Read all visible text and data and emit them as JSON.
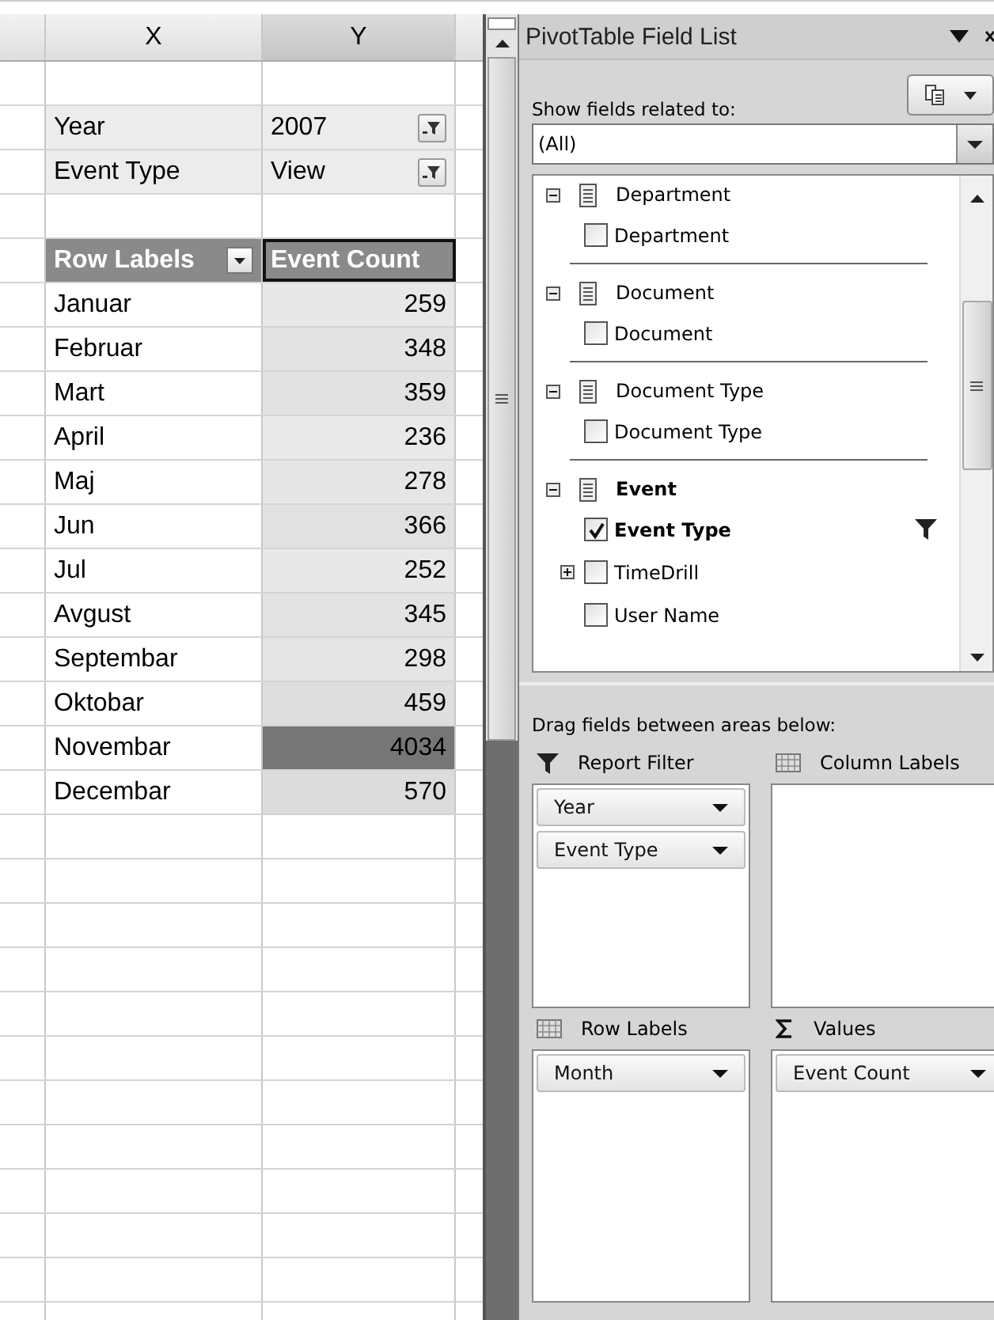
{
  "sheet": {
    "columns": [
      "X",
      "Y"
    ],
    "filters": [
      {
        "label": "Year",
        "value": "2007"
      },
      {
        "label": "Event Type",
        "value": "View"
      }
    ],
    "header": {
      "row_label": "Row Labels",
      "value_label": "Event Count"
    },
    "rows": [
      {
        "label": "Januar",
        "value": "259",
        "color": "#e8e8e8"
      },
      {
        "label": "Februar",
        "value": "348",
        "color": "#e3e3e3"
      },
      {
        "label": "Mart",
        "value": "359",
        "color": "#e2e2e2"
      },
      {
        "label": "April",
        "value": "236",
        "color": "#e9e9e9"
      },
      {
        "label": "Maj",
        "value": "278",
        "color": "#e6e6e6"
      },
      {
        "label": "Jun",
        "value": "366",
        "color": "#e1e1e1"
      },
      {
        "label": "Jul",
        "value": "252",
        "color": "#e8e8e8"
      },
      {
        "label": "Avgust",
        "value": "345",
        "color": "#e3e3e3"
      },
      {
        "label": "Septembar",
        "value": "298",
        "color": "#e5e5e5"
      },
      {
        "label": "Oktobar",
        "value": "459",
        "color": "#dedede"
      },
      {
        "label": "Novembar",
        "value": "4034",
        "color": "#767676"
      },
      {
        "label": "Decembar",
        "value": "570",
        "color": "#dcdcdc"
      }
    ]
  },
  "panel": {
    "title": "PivotTable Field List",
    "related_label": "Show fields related to:",
    "related_value": "(All)",
    "groups": [
      {
        "name": "Department",
        "children": [
          {
            "name": "Department",
            "checked": false
          }
        ]
      },
      {
        "name": "Document",
        "children": [
          {
            "name": "Document",
            "checked": false
          }
        ]
      },
      {
        "name": "Document Type",
        "children": [
          {
            "name": "Document Type",
            "checked": false
          }
        ]
      },
      {
        "name": "Event",
        "children": [
          {
            "name": "Event Type",
            "checked": true,
            "filtered": true
          },
          {
            "name": "TimeDrill",
            "checked": false,
            "expandable": true
          },
          {
            "name": "User Name",
            "checked": false
          }
        ]
      }
    ],
    "drag_hint": "Drag fields between areas below:",
    "areas": [
      {
        "kind": "filter",
        "title": "Report Filter",
        "items": [
          "Year",
          "Event Type"
        ]
      },
      {
        "kind": "columns",
        "title": "Column Labels"
      },
      {
        "kind": "rows",
        "title": "Row Labels",
        "items": [
          "Month"
        ]
      },
      {
        "kind": "values",
        "title": "Values",
        "items": [
          "Event Count"
        ]
      }
    ]
  }
}
